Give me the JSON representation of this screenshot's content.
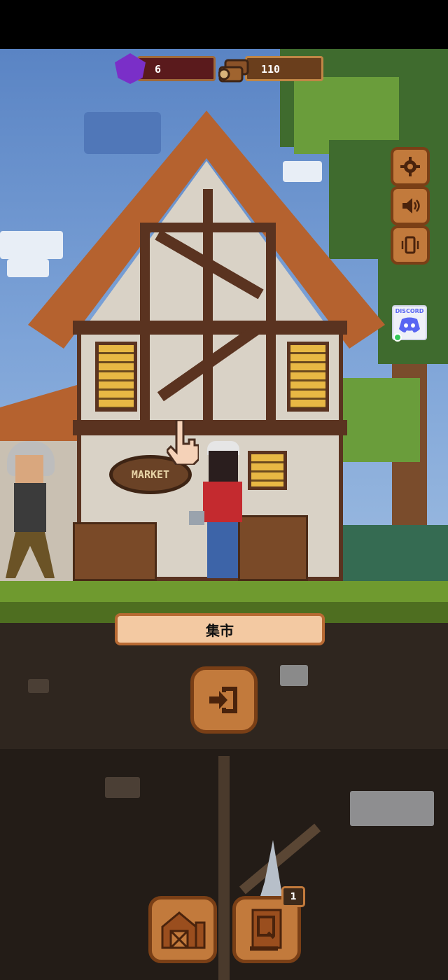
{
  "resources": {
    "gems": "6",
    "wood": "110"
  },
  "scene": {
    "sign_text": "MARKET"
  },
  "location": {
    "name": "集市"
  },
  "discord": {
    "label": "DISCORD"
  },
  "quest_button": {
    "badge_count": "1"
  },
  "icons": {
    "settings": "gear-icon",
    "sound": "speaker-icon",
    "vibration": "vibrate-icon",
    "enter": "enter-door-icon",
    "barn": "barn-icon",
    "quest": "quest-scroll-icon",
    "gem": "purple-gem-icon",
    "wood": "wood-log-icon"
  },
  "colors": {
    "button_fill": "#c27a3c",
    "button_border": "#7a3f16",
    "gem": "#7a2fc8",
    "location_bar": "#f3c9a2"
  }
}
